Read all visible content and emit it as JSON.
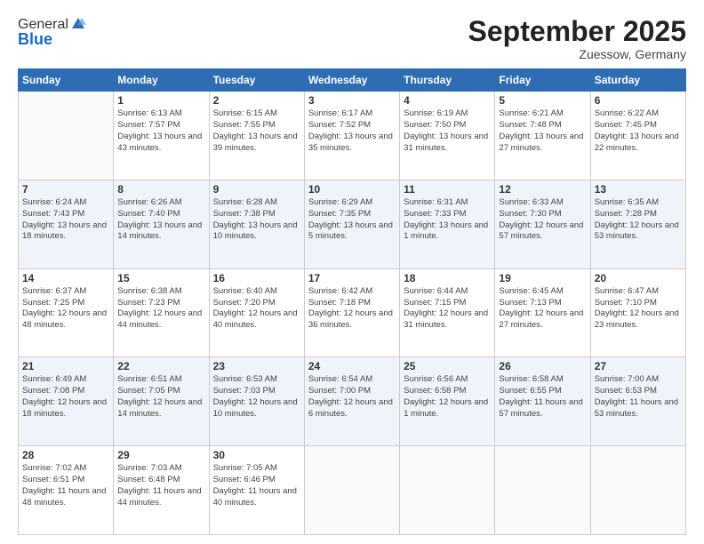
{
  "logo": {
    "general": "General",
    "blue": "Blue"
  },
  "header": {
    "month": "September 2025",
    "location": "Zuessow, Germany"
  },
  "weekdays": [
    "Sunday",
    "Monday",
    "Tuesday",
    "Wednesday",
    "Thursday",
    "Friday",
    "Saturday"
  ],
  "weeks": [
    [
      {
        "date": "",
        "sunrise": "",
        "sunset": "",
        "daylight": ""
      },
      {
        "date": "1",
        "sunrise": "Sunrise: 6:13 AM",
        "sunset": "Sunset: 7:57 PM",
        "daylight": "Daylight: 13 hours and 43 minutes."
      },
      {
        "date": "2",
        "sunrise": "Sunrise: 6:15 AM",
        "sunset": "Sunset: 7:55 PM",
        "daylight": "Daylight: 13 hours and 39 minutes."
      },
      {
        "date": "3",
        "sunrise": "Sunrise: 6:17 AM",
        "sunset": "Sunset: 7:52 PM",
        "daylight": "Daylight: 13 hours and 35 minutes."
      },
      {
        "date": "4",
        "sunrise": "Sunrise: 6:19 AM",
        "sunset": "Sunset: 7:50 PM",
        "daylight": "Daylight: 13 hours and 31 minutes."
      },
      {
        "date": "5",
        "sunrise": "Sunrise: 6:21 AM",
        "sunset": "Sunset: 7:48 PM",
        "daylight": "Daylight: 13 hours and 27 minutes."
      },
      {
        "date": "6",
        "sunrise": "Sunrise: 6:22 AM",
        "sunset": "Sunset: 7:45 PM",
        "daylight": "Daylight: 13 hours and 22 minutes."
      }
    ],
    [
      {
        "date": "7",
        "sunrise": "Sunrise: 6:24 AM",
        "sunset": "Sunset: 7:43 PM",
        "daylight": "Daylight: 13 hours and 18 minutes."
      },
      {
        "date": "8",
        "sunrise": "Sunrise: 6:26 AM",
        "sunset": "Sunset: 7:40 PM",
        "daylight": "Daylight: 13 hours and 14 minutes."
      },
      {
        "date": "9",
        "sunrise": "Sunrise: 6:28 AM",
        "sunset": "Sunset: 7:38 PM",
        "daylight": "Daylight: 13 hours and 10 minutes."
      },
      {
        "date": "10",
        "sunrise": "Sunrise: 6:29 AM",
        "sunset": "Sunset: 7:35 PM",
        "daylight": "Daylight: 13 hours and 5 minutes."
      },
      {
        "date": "11",
        "sunrise": "Sunrise: 6:31 AM",
        "sunset": "Sunset: 7:33 PM",
        "daylight": "Daylight: 13 hours and 1 minute."
      },
      {
        "date": "12",
        "sunrise": "Sunrise: 6:33 AM",
        "sunset": "Sunset: 7:30 PM",
        "daylight": "Daylight: 12 hours and 57 minutes."
      },
      {
        "date": "13",
        "sunrise": "Sunrise: 6:35 AM",
        "sunset": "Sunset: 7:28 PM",
        "daylight": "Daylight: 12 hours and 53 minutes."
      }
    ],
    [
      {
        "date": "14",
        "sunrise": "Sunrise: 6:37 AM",
        "sunset": "Sunset: 7:25 PM",
        "daylight": "Daylight: 12 hours and 48 minutes."
      },
      {
        "date": "15",
        "sunrise": "Sunrise: 6:38 AM",
        "sunset": "Sunset: 7:23 PM",
        "daylight": "Daylight: 12 hours and 44 minutes."
      },
      {
        "date": "16",
        "sunrise": "Sunrise: 6:40 AM",
        "sunset": "Sunset: 7:20 PM",
        "daylight": "Daylight: 12 hours and 40 minutes."
      },
      {
        "date": "17",
        "sunrise": "Sunrise: 6:42 AM",
        "sunset": "Sunset: 7:18 PM",
        "daylight": "Daylight: 12 hours and 36 minutes."
      },
      {
        "date": "18",
        "sunrise": "Sunrise: 6:44 AM",
        "sunset": "Sunset: 7:15 PM",
        "daylight": "Daylight: 12 hours and 31 minutes."
      },
      {
        "date": "19",
        "sunrise": "Sunrise: 6:45 AM",
        "sunset": "Sunset: 7:13 PM",
        "daylight": "Daylight: 12 hours and 27 minutes."
      },
      {
        "date": "20",
        "sunrise": "Sunrise: 6:47 AM",
        "sunset": "Sunset: 7:10 PM",
        "daylight": "Daylight: 12 hours and 23 minutes."
      }
    ],
    [
      {
        "date": "21",
        "sunrise": "Sunrise: 6:49 AM",
        "sunset": "Sunset: 7:08 PM",
        "daylight": "Daylight: 12 hours and 18 minutes."
      },
      {
        "date": "22",
        "sunrise": "Sunrise: 6:51 AM",
        "sunset": "Sunset: 7:05 PM",
        "daylight": "Daylight: 12 hours and 14 minutes."
      },
      {
        "date": "23",
        "sunrise": "Sunrise: 6:53 AM",
        "sunset": "Sunset: 7:03 PM",
        "daylight": "Daylight: 12 hours and 10 minutes."
      },
      {
        "date": "24",
        "sunrise": "Sunrise: 6:54 AM",
        "sunset": "Sunset: 7:00 PM",
        "daylight": "Daylight: 12 hours and 6 minutes."
      },
      {
        "date": "25",
        "sunrise": "Sunrise: 6:56 AM",
        "sunset": "Sunset: 6:58 PM",
        "daylight": "Daylight: 12 hours and 1 minute."
      },
      {
        "date": "26",
        "sunrise": "Sunrise: 6:58 AM",
        "sunset": "Sunset: 6:55 PM",
        "daylight": "Daylight: 11 hours and 57 minutes."
      },
      {
        "date": "27",
        "sunrise": "Sunrise: 7:00 AM",
        "sunset": "Sunset: 6:53 PM",
        "daylight": "Daylight: 11 hours and 53 minutes."
      }
    ],
    [
      {
        "date": "28",
        "sunrise": "Sunrise: 7:02 AM",
        "sunset": "Sunset: 6:51 PM",
        "daylight": "Daylight: 11 hours and 48 minutes."
      },
      {
        "date": "29",
        "sunrise": "Sunrise: 7:03 AM",
        "sunset": "Sunset: 6:48 PM",
        "daylight": "Daylight: 11 hours and 44 minutes."
      },
      {
        "date": "30",
        "sunrise": "Sunrise: 7:05 AM",
        "sunset": "Sunset: 6:46 PM",
        "daylight": "Daylight: 11 hours and 40 minutes."
      },
      {
        "date": "",
        "sunrise": "",
        "sunset": "",
        "daylight": ""
      },
      {
        "date": "",
        "sunrise": "",
        "sunset": "",
        "daylight": ""
      },
      {
        "date": "",
        "sunrise": "",
        "sunset": "",
        "daylight": ""
      },
      {
        "date": "",
        "sunrise": "",
        "sunset": "",
        "daylight": ""
      }
    ]
  ]
}
